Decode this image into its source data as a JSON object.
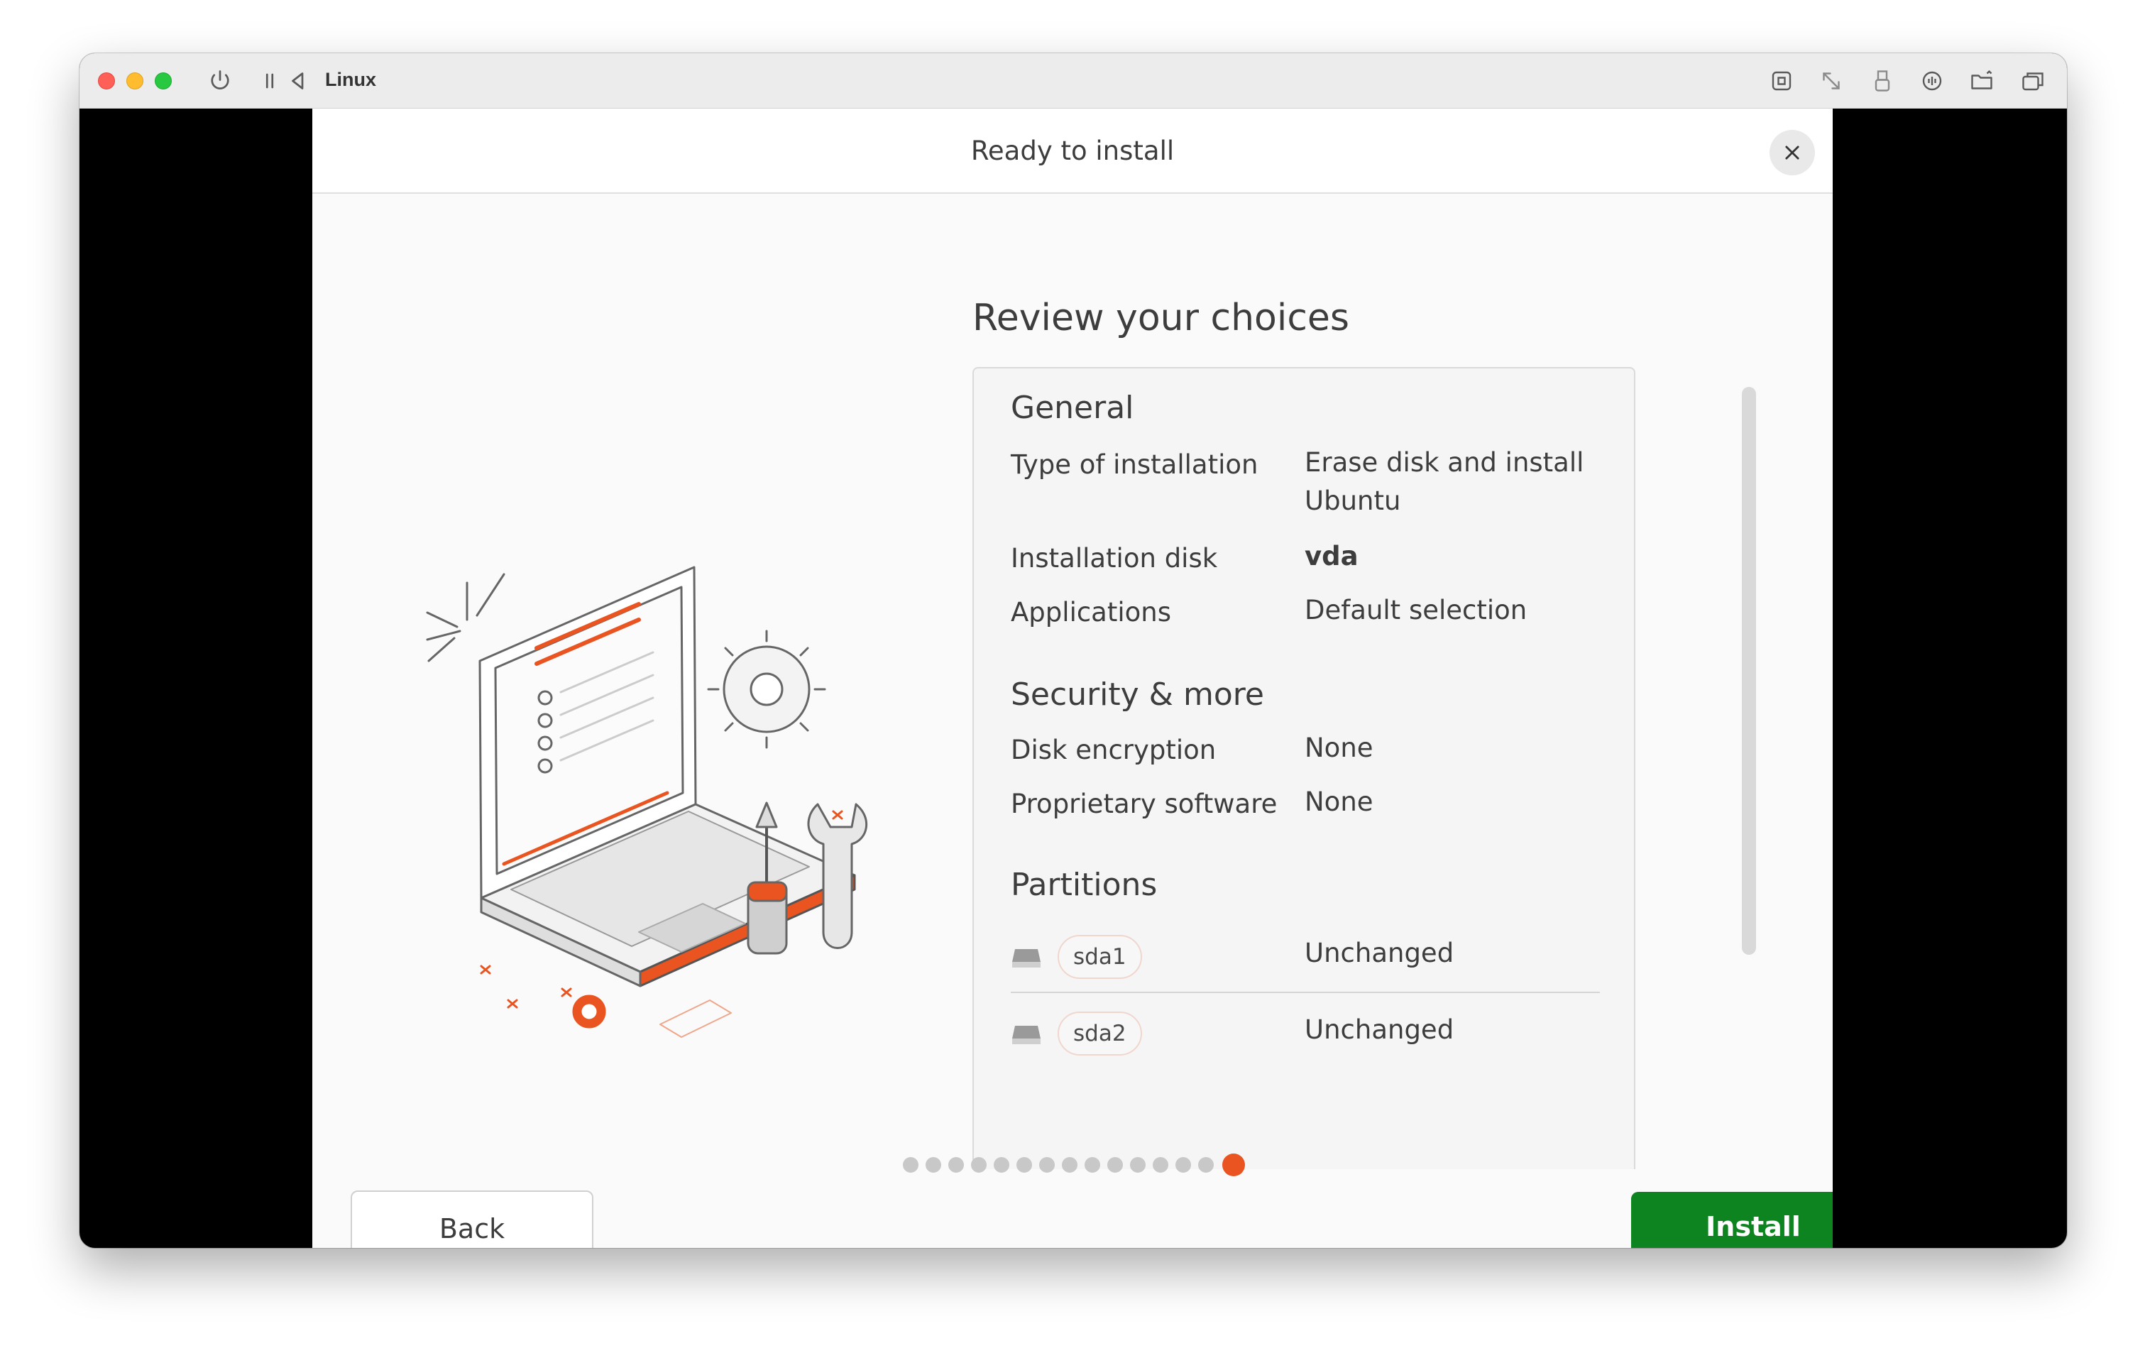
{
  "vm": {
    "title": "Linux",
    "toolbar_left": [
      "power-icon",
      "pause-icon",
      "back-icon"
    ],
    "toolbar_right": [
      "command-key-icon",
      "resize-icon",
      "usb-icon",
      "audio-icon",
      "shared-folder-icon",
      "windows-icon"
    ]
  },
  "dialog": {
    "title": "Ready to install",
    "close_icon": "close-icon"
  },
  "review": {
    "title": "Review your choices",
    "general": {
      "title": "General",
      "rows": [
        {
          "label": "Type of installation",
          "value": "Erase disk and install Ubuntu"
        },
        {
          "label": "Installation disk",
          "value": "vda"
        },
        {
          "label": "Applications",
          "value": "Default selection"
        }
      ]
    },
    "security": {
      "title": "Security & more",
      "rows": [
        {
          "label": "Disk encryption",
          "value": "None"
        },
        {
          "label": "Proprietary software",
          "value": "None"
        }
      ]
    },
    "partitions": {
      "title": "Partitions",
      "items": [
        {
          "name": "sda1",
          "status": "Unchanged"
        },
        {
          "name": "sda2",
          "status": "Unchanged"
        }
      ]
    }
  },
  "footer": {
    "back_label": "Back",
    "install_label": "Install",
    "progress": {
      "total_steps": 15,
      "current_step": 15
    }
  },
  "colors": {
    "accent": "#e95420",
    "install_green": "#0e8420",
    "dot_inactive": "#c8c8c8"
  }
}
